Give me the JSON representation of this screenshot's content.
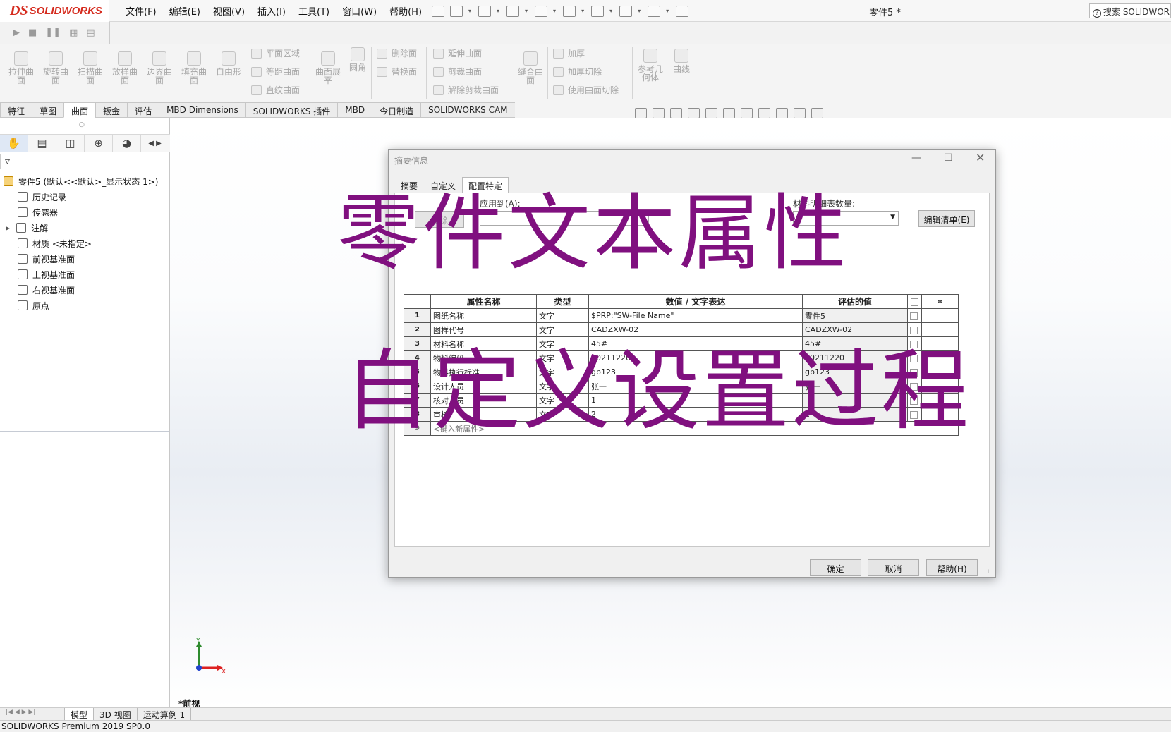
{
  "app": {
    "brand_prefix": "DS",
    "brand_name": "SOLIDWORKS",
    "document_title": "零件5 *",
    "search_placeholder": "搜索 SOLIDWORKS"
  },
  "menu": [
    "文件(F)",
    "编辑(E)",
    "视图(V)",
    "插入(I)",
    "工具(T)",
    "窗口(W)",
    "帮助(H)"
  ],
  "quick_icons": [
    "home-icon",
    "new-icon",
    "open-icon",
    "save-icon",
    "print-icon",
    "undo-icon",
    "select-icon",
    "rebuild-icon",
    "file-properties-icon",
    "options-icon"
  ],
  "macro_icons": [
    "play-icon",
    "stop-icon",
    "pause-icon",
    "edit-macro-icon",
    "new-macro-icon"
  ],
  "command_manager": {
    "big_tools": [
      {
        "label": "拉伸曲面",
        "icon": "extruded-surface-icon"
      },
      {
        "label": "旋转曲面",
        "icon": "revolved-surface-icon"
      },
      {
        "label": "扫描曲面",
        "icon": "swept-surface-icon"
      },
      {
        "label": "放样曲面",
        "icon": "lofted-surface-icon"
      },
      {
        "label": "边界曲面",
        "icon": "boundary-surface-icon"
      },
      {
        "label": "填充曲面",
        "icon": "filled-surface-icon"
      },
      {
        "label": "自由形",
        "icon": "freeform-icon"
      }
    ],
    "group1": [
      "平面区域",
      "等距曲面",
      "直纹曲面"
    ],
    "surface_flatten": "曲面展平",
    "fillet": "圆角",
    "group2": [
      "删除面",
      "替换面"
    ],
    "group3": [
      "延伸曲面",
      "剪裁曲面",
      "解除剪裁曲面"
    ],
    "knit": "缝合曲面",
    "group4": [
      "加厚",
      "加厚切除",
      "使用曲面切除"
    ],
    "ref_geometry": "参考几何体",
    "curves": "曲线"
  },
  "command_tabs": [
    {
      "label": "特征",
      "active": false
    },
    {
      "label": "草图",
      "active": false
    },
    {
      "label": "曲面",
      "active": true
    },
    {
      "label": "钣金",
      "active": false
    },
    {
      "label": "评估",
      "active": false
    },
    {
      "label": "MBD Dimensions",
      "active": false
    },
    {
      "label": "SOLIDWORKS 插件",
      "active": false
    },
    {
      "label": "MBD",
      "active": false
    },
    {
      "label": "今日制造",
      "active": false
    },
    {
      "label": "SOLIDWORKS CAM",
      "active": false
    }
  ],
  "feature_tree": {
    "root": "零件5  (默认<<默认>_显示状态 1>)",
    "items": [
      {
        "label": "历史记录",
        "icon": "history-icon"
      },
      {
        "label": "传感器",
        "icon": "sensor-icon"
      },
      {
        "label": "注解",
        "icon": "annotations-icon"
      },
      {
        "label": "材质 <未指定>",
        "icon": "material-icon"
      },
      {
        "label": "前视基准面",
        "icon": "plane-icon"
      },
      {
        "label": "上视基准面",
        "icon": "plane-icon"
      },
      {
        "label": "右视基准面",
        "icon": "plane-icon"
      },
      {
        "label": "原点",
        "icon": "origin-icon"
      }
    ]
  },
  "bottom_tabs": [
    "模型",
    "3D 视图",
    "运动算例 1"
  ],
  "status_bar": "SOLIDWORKS Premium 2019 SP0.0",
  "view_label": "*前视",
  "triad": {
    "y": "Y",
    "x": "X"
  },
  "dialog": {
    "title": "摘要信息",
    "tabs": [
      {
        "label": "摘要",
        "active": false
      },
      {
        "label": "自定义",
        "active": false
      },
      {
        "label": "配置特定",
        "active": true
      }
    ],
    "apply_to_label": "应用到(A):",
    "bom_qty_label": "材料明细表数量:",
    "delete_button": "删除",
    "edit_list_button": "编辑清单(E)",
    "columns": [
      "属性名称",
      "类型",
      "数值 / 文字表达",
      "评估的值",
      "link-icon"
    ],
    "rows": [
      {
        "num": "1",
        "name": "图纸名称",
        "type": "文字",
        "value": "$PRP:\"SW-File Name\"",
        "evaluated": "零件5"
      },
      {
        "num": "2",
        "name": "图样代号",
        "type": "文字",
        "value": "CADZXW-02",
        "evaluated": "CADZXW-02"
      },
      {
        "num": "3",
        "name": "材料名称",
        "type": "文字",
        "value": "45#",
        "evaluated": "45#"
      },
      {
        "num": "4",
        "name": "物料编码",
        "type": "文字",
        "value": "20211220",
        "evaluated": "20211220"
      },
      {
        "num": "5",
        "name": "物料执行标准",
        "type": "文字",
        "value": "gb123",
        "evaluated": "gb123"
      },
      {
        "num": "6",
        "name": "设计人员",
        "type": "文字",
        "value": "张一",
        "evaluated": "张一"
      },
      {
        "num": "7",
        "name": "核对人员",
        "type": "文字",
        "value": "1",
        "evaluated": ""
      },
      {
        "num": "8",
        "name": "审核",
        "type": "文字",
        "value": "2",
        "evaluated": "2"
      }
    ],
    "new_row": {
      "num": "9",
      "name": "<键入新属性>"
    },
    "buttons": {
      "ok": "确定",
      "cancel": "取消",
      "help": "帮助(H)"
    }
  },
  "overlay": {
    "line1": "零件文本属性",
    "line2": "自定义设置过程",
    "color": "#80107f"
  }
}
